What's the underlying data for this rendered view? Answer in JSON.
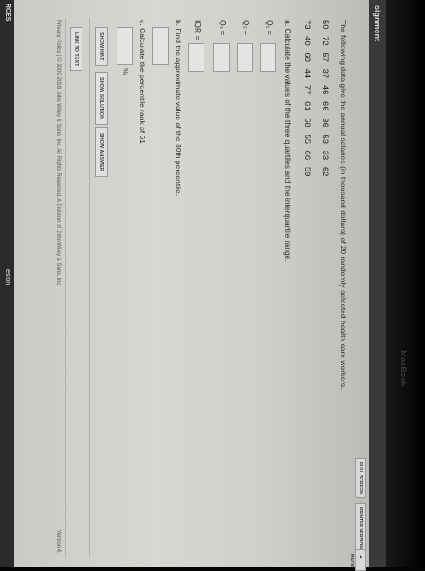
{
  "header": {
    "title": "signment"
  },
  "sidebar": {
    "label": "RCES",
    "side_labels": [
      "eston"
    ]
  },
  "top_buttons": [
    "FULL SCREEN",
    "PRINTER VERSION",
    "◄ BACK"
  ],
  "question": {
    "prompt": "The following data give the annual salaries (in thousand dollars) of 20 randomly selected health care workers.",
    "row1": "50 72 57 37 46 66 36 53 33 62",
    "row2": "73 40 68 44 77 61 58 55 66 59",
    "part_a": "a. Calculate the values of the three quartiles and the interquartile range.",
    "q1_label": "Q₁ =",
    "q2_label": "Q₂ =",
    "q3_label": "Q₃ =",
    "iqr_label": "IQR =",
    "part_b": "b. Find the approximate value of the 30th percentile.",
    "part_c": "c. Calculate the percentile rank of 61.",
    "percent_sign": "%"
  },
  "actions": {
    "show_hint": "SHOW HINT",
    "show_solution": "SHOW SOLUTION",
    "show_answer": "SHOW ANSWER",
    "link_to_text": "LINK TO TEXT"
  },
  "footer": {
    "privacy": "Privacy Policy",
    "sep": "|",
    "copyright": "© 2000-2018 John Wiley & Sons, Inc. All Rights Reserved. A Division of John Wiley & Sons, Inc.",
    "version": "Version 4."
  },
  "device": {
    "brand": "MacBook"
  }
}
